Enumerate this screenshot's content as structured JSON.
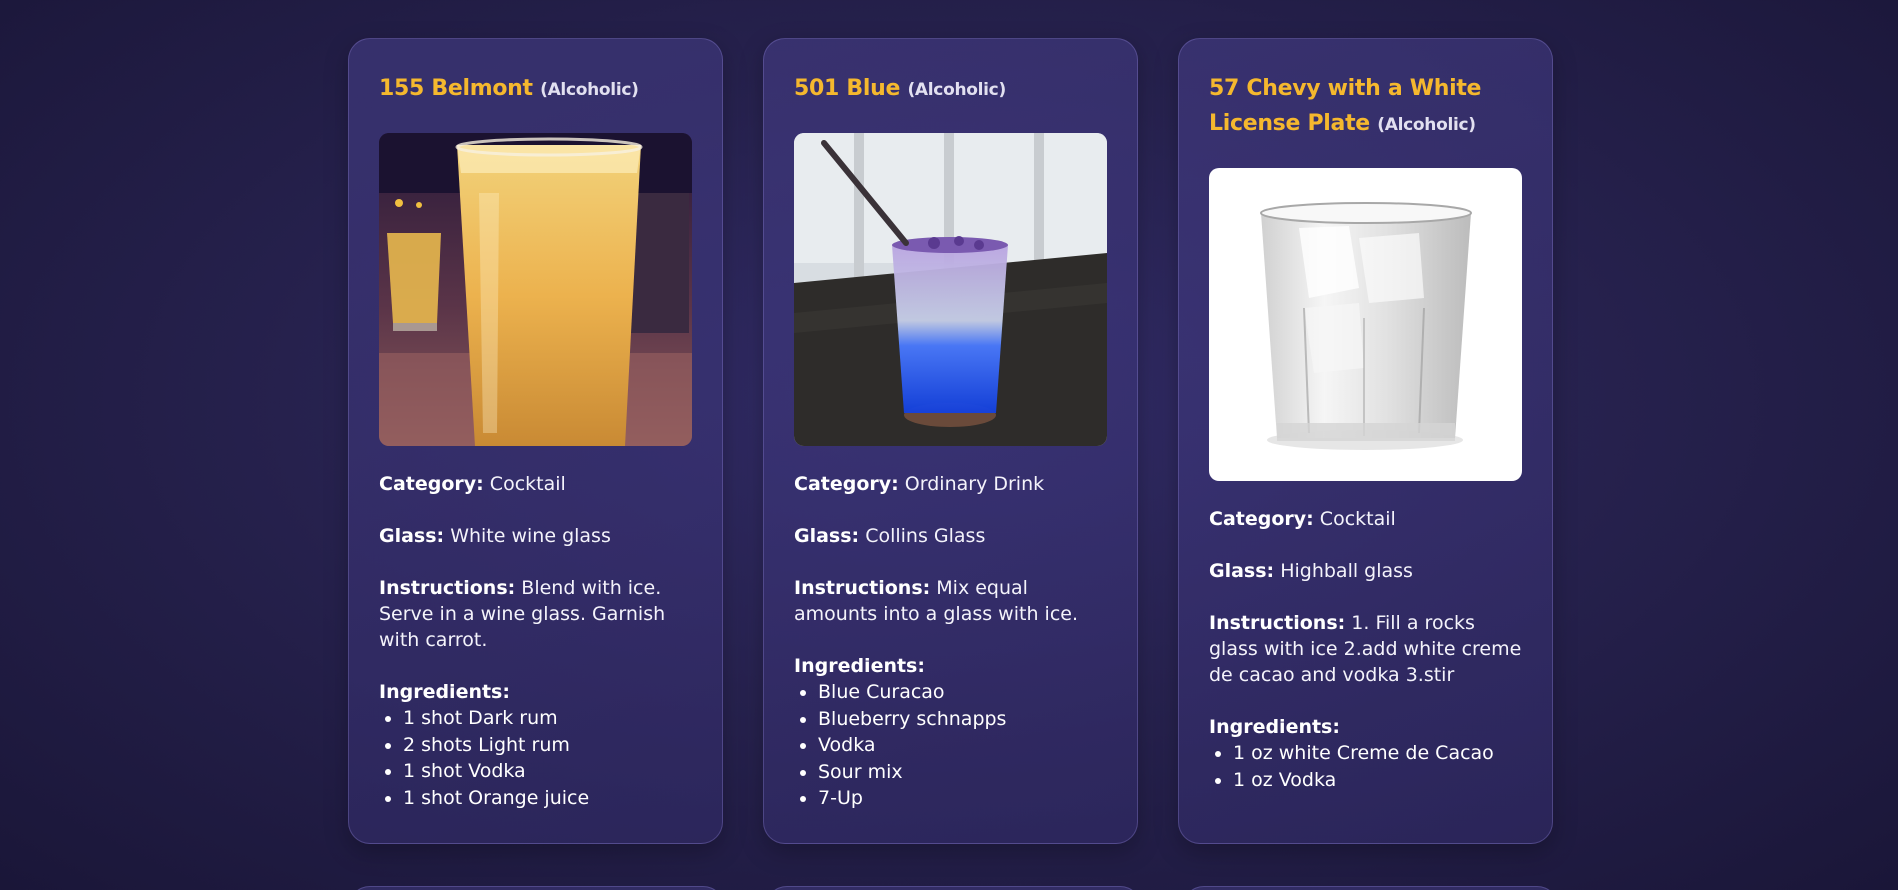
{
  "cards": [
    {
      "name": "155 Belmont",
      "alcoholic": "(Alcoholic)",
      "category_label": "Category:",
      "category": "Cocktail",
      "glass_label": "Glass:",
      "glass": "White wine glass",
      "instructions_label": "Instructions:",
      "instructions": "Blend with ice. Serve in a wine glass. Garnish with carrot.",
      "ingredients_label": "Ingredients:",
      "ingredients": [
        "1 shot Dark rum",
        "2 shots Light rum",
        "1 shot Vodka",
        "1 shot Orange juice"
      ]
    },
    {
      "name": "501 Blue",
      "alcoholic": "(Alcoholic)",
      "category_label": "Category:",
      "category": "Ordinary Drink",
      "glass_label": "Glass:",
      "glass": "Collins Glass",
      "instructions_label": "Instructions:",
      "instructions": "Mix equal amounts into a glass with ice.",
      "ingredients_label": "Ingredients:",
      "ingredients": [
        "Blue Curacao",
        "Blueberry schnapps",
        "Vodka",
        "Sour mix",
        "7-Up"
      ]
    },
    {
      "name": "57 Chevy with a White License Plate",
      "alcoholic": "(Alcoholic)",
      "category_label": "Category:",
      "category": "Cocktail",
      "glass_label": "Glass:",
      "glass": "Highball glass",
      "instructions_label": "Instructions:",
      "instructions": "1. Fill a rocks glass with ice 2.add white creme de cacao and vodka 3.stir",
      "ingredients_label": "Ingredients:",
      "ingredients": [
        "1 oz white Creme de Cacao",
        "1 oz Vodka"
      ]
    }
  ],
  "colors": {
    "title_accent": "#f5b82e",
    "background": "#27224f",
    "card_border": "#8c82d2"
  }
}
